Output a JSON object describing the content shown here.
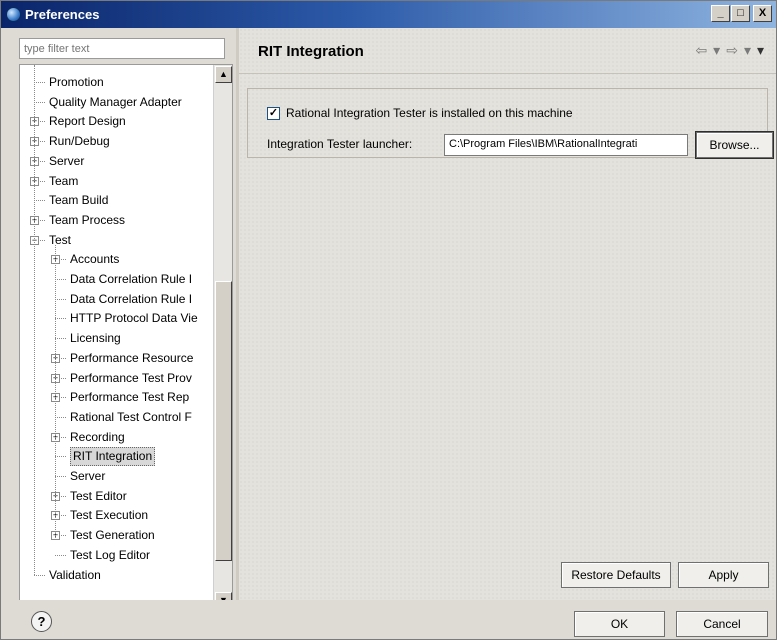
{
  "window": {
    "title": "Preferences"
  },
  "filter": {
    "placeholder": "type filter text"
  },
  "tree": {
    "items": [
      {
        "label": "Promotion"
      },
      {
        "label": "Quality Manager Adapter"
      },
      {
        "label": "Report Design"
      },
      {
        "label": "Run/Debug"
      },
      {
        "label": "Server"
      },
      {
        "label": "Team"
      },
      {
        "label": "Team Build"
      },
      {
        "label": "Team Process"
      },
      {
        "label": "Test"
      },
      {
        "label": "Accounts"
      },
      {
        "label": "Data Correlation Rule I"
      },
      {
        "label": "Data Correlation Rule I"
      },
      {
        "label": "HTTP Protocol Data Vie"
      },
      {
        "label": "Licensing"
      },
      {
        "label": "Performance Resource"
      },
      {
        "label": "Performance Test Prov"
      },
      {
        "label": "Performance Test Rep"
      },
      {
        "label": "Rational Test Control F"
      },
      {
        "label": "Recording"
      },
      {
        "label": "RIT Integration"
      },
      {
        "label": "Server"
      },
      {
        "label": "Test Editor"
      },
      {
        "label": "Test Execution"
      },
      {
        "label": "Test Generation"
      },
      {
        "label": "Test Log Editor"
      },
      {
        "label": "Validation"
      }
    ]
  },
  "page": {
    "title": "RIT Integration",
    "checkbox_label": "Rational Integration Tester is installed on this machine",
    "launcher_label": "Integration Tester launcher:",
    "launcher_value": "C:\\Program Files\\IBM\\RationalIntegrati",
    "browse_label": "Browse...",
    "restore_label": "Restore Defaults",
    "apply_label": "Apply"
  },
  "dialog": {
    "ok_label": "OK",
    "cancel_label": "Cancel",
    "help_glyph": "?"
  },
  "icons": {
    "minimize": "_",
    "maximize": "□",
    "close": "X",
    "back": "⇦",
    "forward": "⇨",
    "dropdown": "▾"
  }
}
